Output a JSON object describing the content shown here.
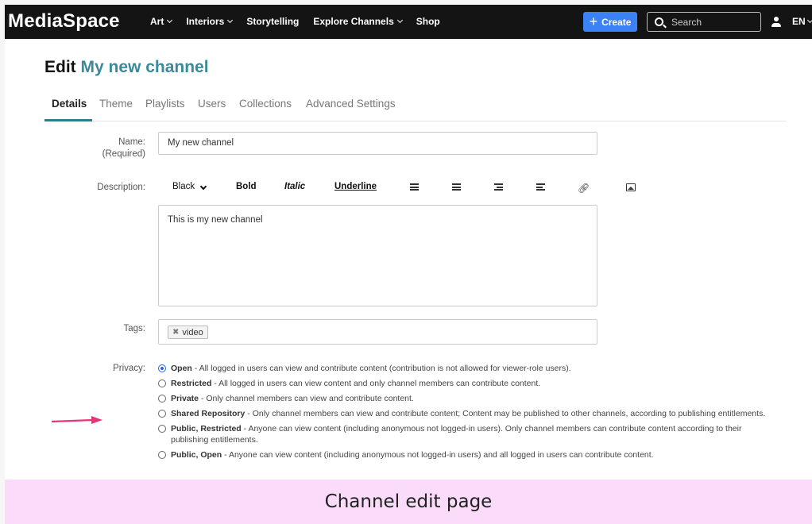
{
  "header": {
    "logo": "MediaSpace",
    "nav": [
      "Art",
      "Interiors",
      "Storytelling",
      "Explore Channels",
      "Shop"
    ],
    "nav_dropdown": [
      true,
      true,
      false,
      true,
      false
    ],
    "create_label": "Create",
    "search_placeholder": "Search",
    "language": "EN"
  },
  "page": {
    "title_prefix": "Edit",
    "title_name": "My new channel"
  },
  "tabs": [
    "Details",
    "Theme",
    "Playlists",
    "Users",
    "Collections",
    "Advanced Settings"
  ],
  "active_tab": "Details",
  "form": {
    "name_label": "Name:",
    "name_required": "(Required)",
    "name_value": "My new channel",
    "description_label": "Description:",
    "toolbar": {
      "color": "Black",
      "bold": "Bold",
      "italic": "Italic",
      "underline": "Underline",
      "icons": [
        "bullet-list-icon",
        "numbered-list-icon",
        "outdent-icon",
        "indent-icon",
        "link-icon",
        "image-icon"
      ]
    },
    "description_value": "This is my new channel",
    "tags_label": "Tags:",
    "tags": [
      "video"
    ],
    "privacy_label": "Privacy:",
    "privacy_options": [
      {
        "name": "Open",
        "desc": " - All logged in users can view and contribute content (contribution is not allowed for viewer-role users).",
        "checked": true
      },
      {
        "name": "Restricted",
        "desc": " - All logged in users can view content and only channel members can contribute content.",
        "checked": false
      },
      {
        "name": "Private",
        "desc": " - Only channel members can view and contribute content.",
        "checked": false
      },
      {
        "name": "Shared Repository",
        "desc": " - Only channel members can view and contribute content; Content may be published to other channels, according to publishing entitlements.",
        "checked": false
      },
      {
        "name": "Public, Restricted",
        "desc": " - Anyone can view content (including anonymous not logged-in users). Only channel members can contribute content according to their publishing entitlements.",
        "checked": false
      },
      {
        "name": "Public, Open",
        "desc": " - Anyone can view content (including anonymous not logged-in users) and all logged in users can contribute content.",
        "checked": false
      }
    ]
  },
  "caption": "Channel edit page",
  "colors": {
    "accent_teal": "#3a8a99",
    "create_blue": "#3b82f6",
    "arrow_pink": "#e8357a",
    "caption_bg": "#fadcfa"
  }
}
